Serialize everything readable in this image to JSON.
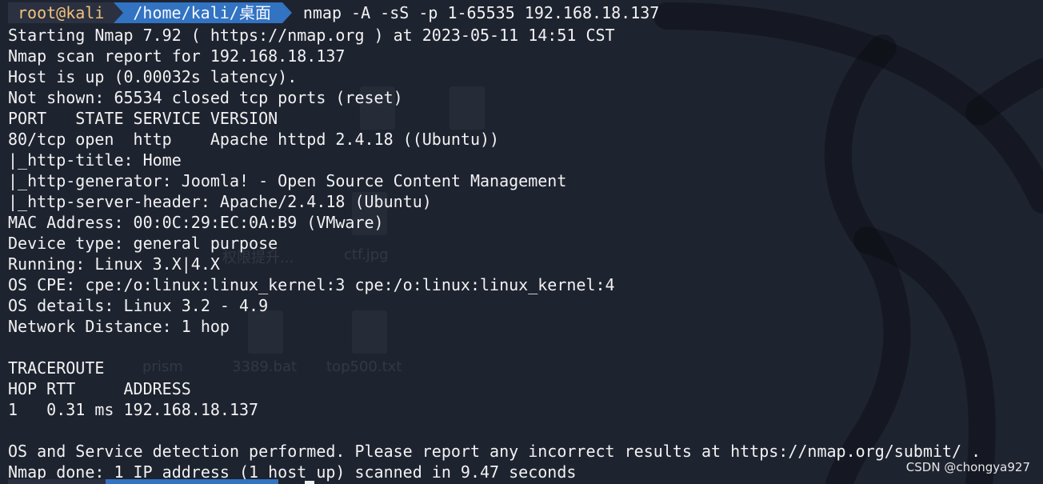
{
  "prompt": {
    "user_host": "root@kali",
    "path": "/home/kali/桌面",
    "command": "nmap -A -sS -p 1-65535 192.168.18.137"
  },
  "output": {
    "l01": "Starting Nmap 7.92 ( https://nmap.org ) at 2023-05-11 14:51 CST",
    "l02": "Nmap scan report for 192.168.18.137",
    "l03": "Host is up (0.00032s latency).",
    "l04": "Not shown: 65534 closed tcp ports (reset)",
    "l05": "PORT   STATE SERVICE VERSION",
    "l06": "80/tcp open  http    Apache httpd 2.4.18 ((Ubuntu))",
    "l07": "|_http-title: Home",
    "l08": "|_http-generator: Joomla! - Open Source Content Management",
    "l09": "|_http-server-header: Apache/2.4.18 (Ubuntu)",
    "l10": "MAC Address: 00:0C:29:EC:0A:B9 (VMware)",
    "l11": "Device type: general purpose",
    "l12": "Running: Linux 3.X|4.X",
    "l13": "OS CPE: cpe:/o:linux:linux_kernel:3 cpe:/o:linux:linux_kernel:4",
    "l14": "OS details: Linux 3.2 - 4.9",
    "l15": "Network Distance: 1 hop",
    "l16": "",
    "l17": "TRACEROUTE",
    "l18": "HOP RTT     ADDRESS",
    "l19": "1   0.31 ms 192.168.18.137",
    "l20": "",
    "l21": "OS and Service detection performed. Please report any incorrect results at https://nmap.org/submit/ .",
    "l22": "Nmap done: 1 IP address (1 host up) scanned in 9.47 seconds"
  },
  "background_labels": {
    "b1": "权限提升...",
    "b2": "ctf.jpg",
    "b3": "prism",
    "b4": "3389.bat",
    "b5": "top500.txt"
  },
  "watermark": "CSDN @chongya927",
  "colors": {
    "background": "#1e2330",
    "prompt_user_bg": "#2b3140",
    "prompt_user_fg": "#f1c27d",
    "prompt_path_bg": "#3273c2",
    "text": "#f2f2f2"
  }
}
